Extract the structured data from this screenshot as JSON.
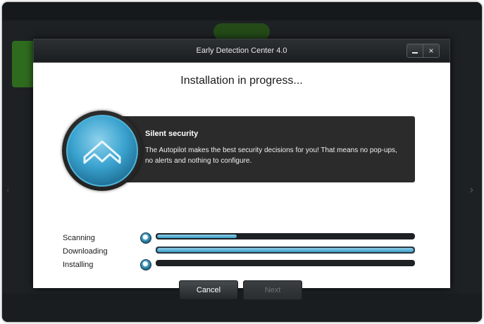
{
  "window": {
    "title": "Early Detection Center 4.0",
    "minimize_label": "_",
    "close_label": "×"
  },
  "main": {
    "heading": "Installation in progress..."
  },
  "info": {
    "title": "Silent security",
    "text": "The Autopilot makes the best security decisions for you! That means no pop-ups, no alerts and nothing to configure."
  },
  "progress": [
    {
      "label": "Scanning",
      "value": 0.31
    },
    {
      "label": "Downloading",
      "value": 1.0
    },
    {
      "label": "Installing",
      "value": 0.0
    }
  ],
  "buttons": {
    "cancel": "Cancel",
    "next": "Next"
  },
  "colors": {
    "accent": "#3a9cc6",
    "dialog_chrome": "#1b1e20",
    "panel": "#2b2b2b"
  },
  "icons": [
    "autopilot-logo-icon",
    "spinner-icon",
    "minimize-icon",
    "close-icon"
  ]
}
